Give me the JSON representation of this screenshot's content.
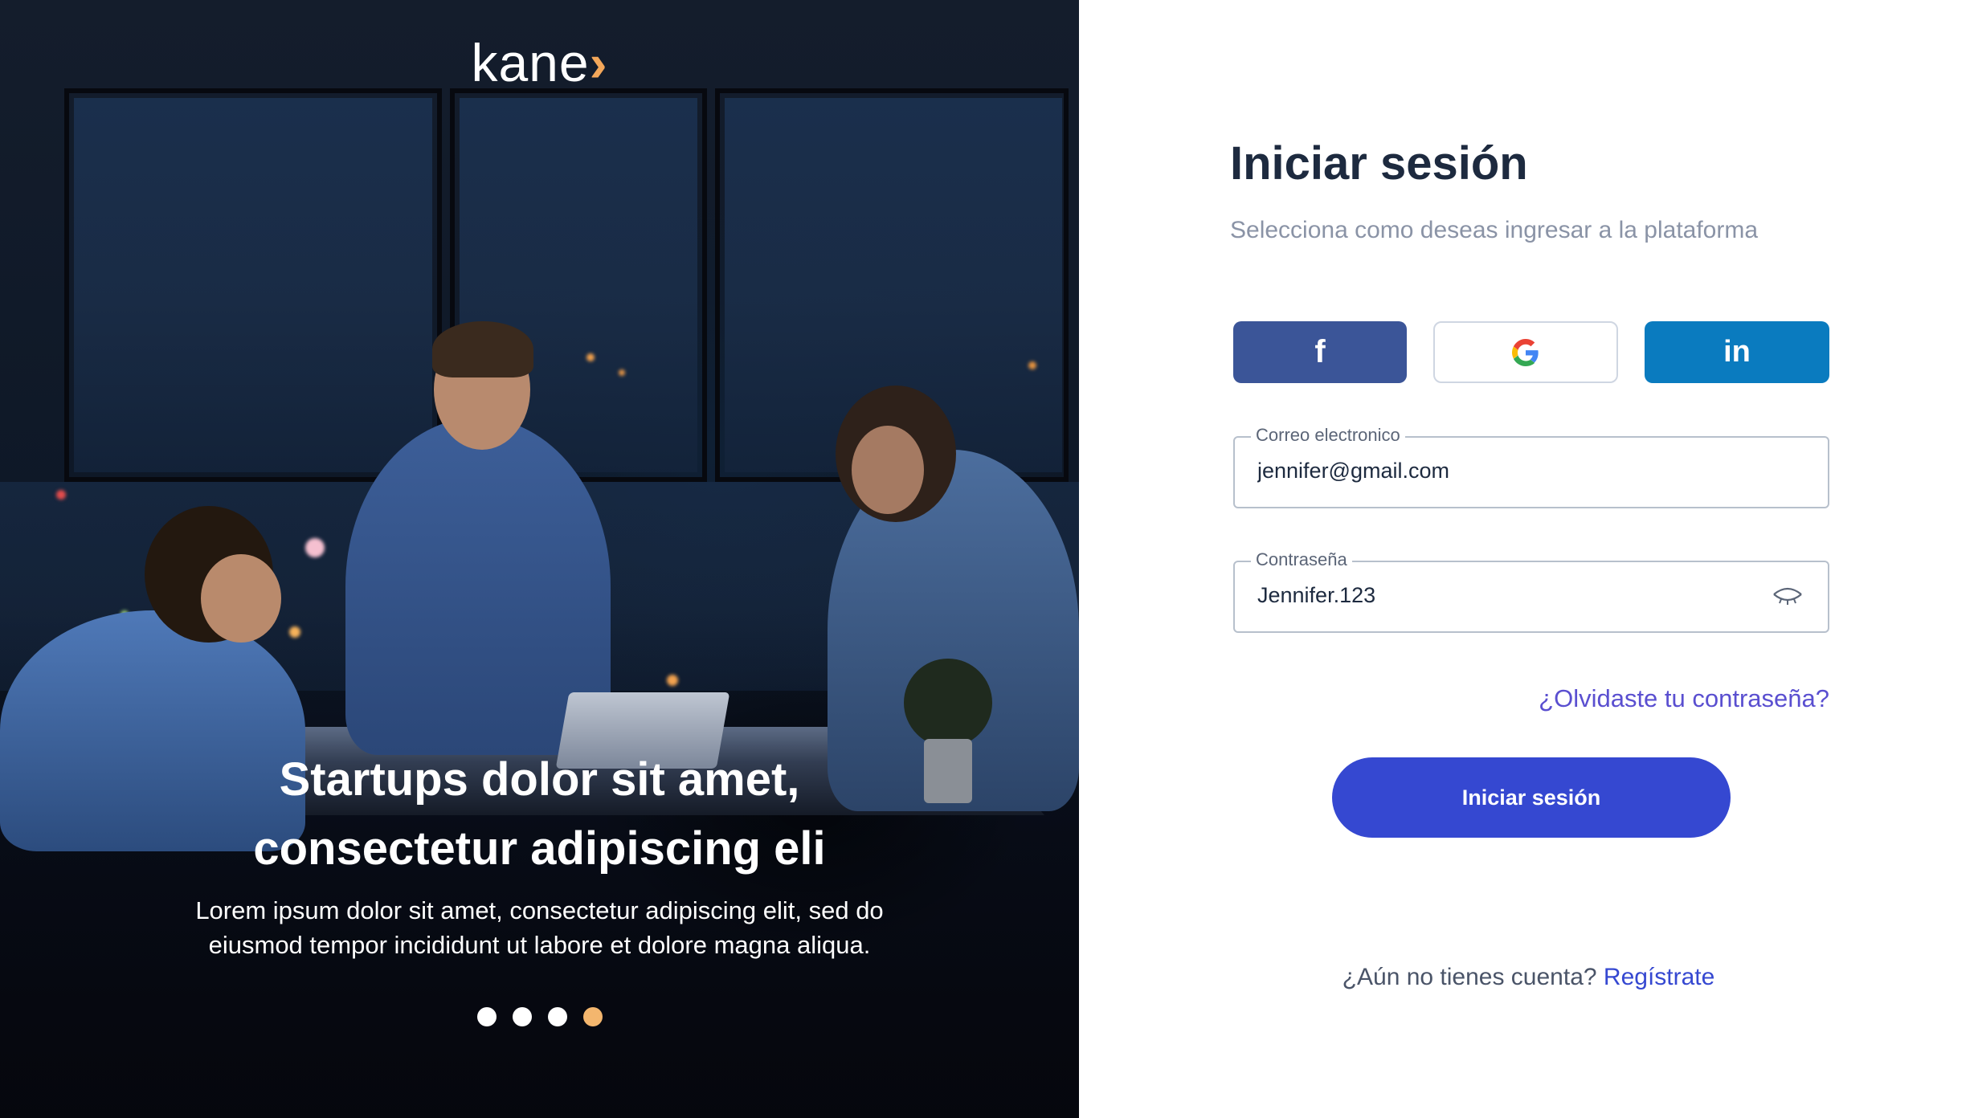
{
  "hero": {
    "logo_text": "kane",
    "logo_chevron": "›",
    "title_line1": "Startups dolor sit amet,",
    "title_line2": "consectetur adipiscing eli",
    "text_line1": "Lorem ipsum dolor sit amet, consectetur adipiscing elit, sed do",
    "text_line2": "eiusmod tempor incididunt ut labore et dolore magna aliqua.",
    "carousel": {
      "total": 4,
      "active_index": 3
    }
  },
  "login": {
    "title": "Iniciar sesión",
    "subtitle": "Selecciona como deseas ingresar a la plataforma",
    "social": [
      {
        "name": "facebook",
        "glyph": "f",
        "color": "#3b5598"
      },
      {
        "name": "google",
        "icon": "google-g-icon"
      },
      {
        "name": "linkedin",
        "glyph": "in",
        "color": "#0a7bbf"
      }
    ],
    "email": {
      "label": "Correo electronico",
      "value": "jennifer@gmail.com"
    },
    "password": {
      "label": "Contraseña",
      "value": "Jennifer.123",
      "toggle_icon": "eye-closed-icon"
    },
    "forgot_link": "¿Olvidaste tu contraseña?",
    "submit_label": "Iniciar sesión",
    "signup_prompt": "¿Aún no tienes cuenta?",
    "signup_link": "Regístrate"
  },
  "colors": {
    "primary": "#3548d1",
    "link": "#5a4fd0",
    "accent": "#f3b66e",
    "heading": "#1d2a3f",
    "muted": "#8a93a6"
  }
}
